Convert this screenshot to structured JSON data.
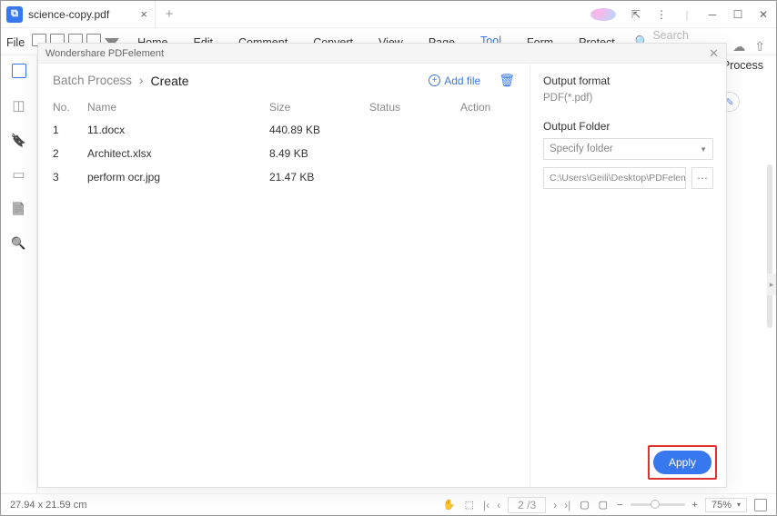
{
  "titlebar": {
    "tab_name": "science-copy.pdf"
  },
  "file_label": "File",
  "menu": {
    "home": "Home",
    "edit": "Edit",
    "comment": "Comment",
    "convert": "Convert",
    "view": "View",
    "page": "Page",
    "tool": "Tool",
    "form": "Form",
    "protect": "Protect",
    "search_ph": "Search Tools"
  },
  "right_label": "Process",
  "modal": {
    "title": "Wondershare PDFelement",
    "crumb_root": "Batch Process",
    "crumb_cur": "Create",
    "add_file": "Add file",
    "headers": {
      "no": "No.",
      "name": "Name",
      "size": "Size",
      "status": "Status",
      "action": "Action"
    },
    "rows": [
      {
        "no": "1",
        "name": "11.docx",
        "size": "440.89 KB",
        "status": "",
        "action": ""
      },
      {
        "no": "2",
        "name": "Architect.xlsx",
        "size": "8.49 KB",
        "status": "",
        "action": ""
      },
      {
        "no": "3",
        "name": "perform ocr.jpg",
        "size": "21.47 KB",
        "status": "",
        "action": ""
      }
    ],
    "output_format_lbl": "Output format",
    "output_format_val": "PDF(*.pdf)",
    "output_folder_lbl": "Output Folder",
    "folder_select_ph": "Specify folder",
    "folder_path": "C:\\Users\\Geili\\Desktop\\PDFelement\\Cr",
    "apply": "Apply"
  },
  "status": {
    "dims": "27.94 x 21.59 cm",
    "page": "2 /3",
    "zoom": "75%"
  }
}
